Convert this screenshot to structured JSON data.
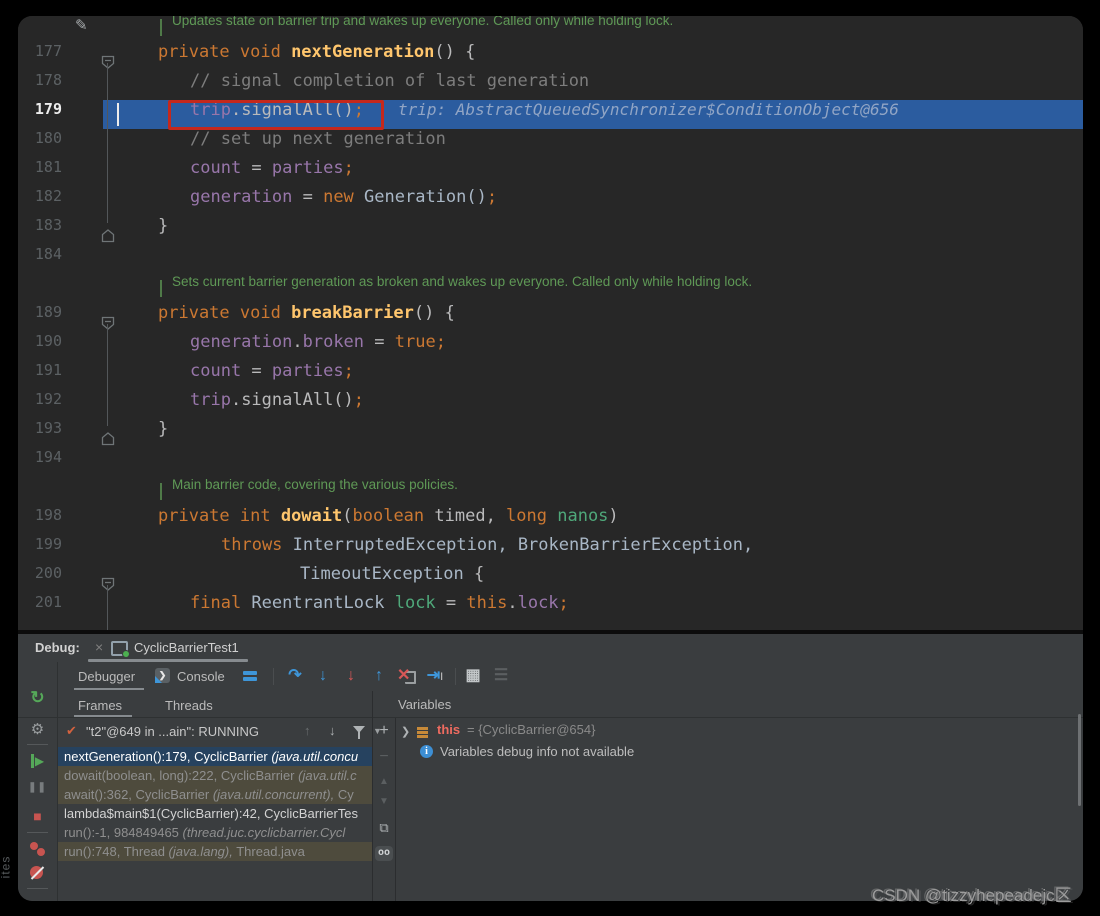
{
  "watermark": "CSDN @tizzyhepeadejc区",
  "side_label": "ites",
  "editor": {
    "lines": [
      {
        "type": "doc",
        "text": "Updates state on barrier trip and wakes up everyone. Called only while holding lock."
      },
      {
        "type": "code",
        "num": "177",
        "fold": "start",
        "indent": 0,
        "seg": [
          [
            "private void ",
            "k"
          ],
          [
            "nextGeneration",
            "m"
          ],
          [
            "() {",
            "p"
          ]
        ]
      },
      {
        "type": "code",
        "num": "178",
        "indent": 1,
        "seg": [
          [
            "// signal completion of last generation",
            "c"
          ]
        ]
      },
      {
        "type": "code",
        "num": "179",
        "exec": true,
        "box": true,
        "indent": 1,
        "seg": [
          [
            "trip",
            "f"
          ],
          [
            ".signalAll()",
            "p"
          ],
          [
            ";",
            "k"
          ]
        ],
        "hint": "trip: AbstractQueuedSynchronizer$ConditionObject@656"
      },
      {
        "type": "code",
        "num": "180",
        "indent": 1,
        "seg": [
          [
            "// set up next generation",
            "c"
          ]
        ]
      },
      {
        "type": "code",
        "num": "181",
        "indent": 1,
        "seg": [
          [
            "count",
            "f"
          ],
          [
            " = ",
            "p"
          ],
          [
            "parties",
            "f"
          ],
          [
            ";",
            "k"
          ]
        ]
      },
      {
        "type": "code",
        "num": "182",
        "indent": 1,
        "seg": [
          [
            "generation",
            "f"
          ],
          [
            " = ",
            "p"
          ],
          [
            "new ",
            "k"
          ],
          [
            "Generation()",
            "t"
          ],
          [
            ";",
            "k"
          ]
        ]
      },
      {
        "type": "code",
        "num": "183",
        "fold": "end",
        "indent": 0,
        "seg": [
          [
            "}",
            "p"
          ]
        ]
      },
      {
        "type": "code",
        "num": "184",
        "indent": 0,
        "seg": []
      },
      {
        "type": "doc",
        "text": "Sets current barrier generation as broken and wakes up everyone. Called only while holding lock."
      },
      {
        "type": "code",
        "num": "189",
        "fold": "start",
        "indent": 0,
        "seg": [
          [
            "private void ",
            "k"
          ],
          [
            "breakBarrier",
            "m"
          ],
          [
            "() {",
            "p"
          ]
        ]
      },
      {
        "type": "code",
        "num": "190",
        "indent": 1,
        "seg": [
          [
            "generation",
            "f"
          ],
          [
            ".",
            "p"
          ],
          [
            "broken",
            "f"
          ],
          [
            " = ",
            "p"
          ],
          [
            "true",
            "k"
          ],
          [
            ";",
            "k"
          ]
        ]
      },
      {
        "type": "code",
        "num": "191",
        "indent": 1,
        "seg": [
          [
            "count",
            "f"
          ],
          [
            " = ",
            "p"
          ],
          [
            "parties",
            "f"
          ],
          [
            ";",
            "k"
          ]
        ]
      },
      {
        "type": "code",
        "num": "192",
        "indent": 1,
        "seg": [
          [
            "trip",
            "f"
          ],
          [
            ".signalAll()",
            "p"
          ],
          [
            ";",
            "k"
          ]
        ]
      },
      {
        "type": "code",
        "num": "193",
        "fold": "end",
        "indent": 0,
        "seg": [
          [
            "}",
            "p"
          ]
        ]
      },
      {
        "type": "code",
        "num": "194",
        "indent": 0,
        "seg": []
      },
      {
        "type": "doc",
        "text": "Main barrier code, covering the various policies."
      },
      {
        "type": "code",
        "num": "198",
        "indent": 0,
        "seg": [
          [
            "private int ",
            "k"
          ],
          [
            "dowait",
            "m"
          ],
          [
            "(",
            "p"
          ],
          [
            "boolean",
            "k"
          ],
          [
            " timed, ",
            "p"
          ],
          [
            "long ",
            "k"
          ],
          [
            "nanos",
            "g"
          ],
          [
            ")",
            "p"
          ]
        ]
      },
      {
        "type": "code",
        "num": "199",
        "indent": 2,
        "seg": [
          [
            "throws ",
            "k"
          ],
          [
            "InterruptedException, BrokenBarrierException,",
            "t"
          ]
        ]
      },
      {
        "type": "code",
        "num": "200",
        "fold": "start",
        "indent": 3,
        "seg": [
          [
            "TimeoutException",
            "t"
          ],
          [
            " {",
            "p"
          ]
        ]
      },
      {
        "type": "code",
        "num": "201",
        "indent": 1,
        "seg": [
          [
            "final ",
            "k"
          ],
          [
            "ReentrantLock ",
            "t"
          ],
          [
            "lock",
            "g"
          ],
          [
            " = ",
            "p"
          ],
          [
            "this",
            "k"
          ],
          [
            ".",
            "p"
          ],
          [
            "lock",
            "f"
          ],
          [
            ";",
            "k"
          ]
        ]
      }
    ]
  },
  "debug": {
    "header": {
      "label": "Debug:",
      "close": "×",
      "tab": "CyclicBarrierTest1"
    },
    "tabs": {
      "debugger": "Debugger",
      "console": "Console"
    },
    "subtabs": {
      "frames": "Frames",
      "threads": "Threads"
    },
    "thread": "\"t2\"@649 in ...ain\": RUNNING",
    "frames": [
      {
        "style": "selected",
        "parts": [
          [
            "nextGeneration():179, CyclicBarrier ",
            "n"
          ],
          [
            "(java.util.concu",
            "i"
          ]
        ]
      },
      {
        "style": "lib",
        "parts": [
          [
            "dowait(boolean, long):222, CyclicBarrier ",
            "n"
          ],
          [
            "(java.util.c",
            "i"
          ]
        ]
      },
      {
        "style": "lib",
        "parts": [
          [
            "await():362, CyclicBarrier ",
            "n"
          ],
          [
            "(java.util.concurrent),",
            "i"
          ],
          [
            " Cy",
            "n"
          ]
        ]
      },
      {
        "style": "bright",
        "parts": [
          [
            "lambda$main$1(CyclicBarrier):42, CyclicBarrierTes",
            "n"
          ]
        ]
      },
      {
        "style": "dim",
        "parts": [
          [
            "run():-1, 984849465 ",
            "n"
          ],
          [
            "(thread.juc.cyclicbarrier.Cycl",
            "i"
          ]
        ]
      },
      {
        "style": "lib",
        "parts": [
          [
            "run():748, Thread ",
            "n"
          ],
          [
            "(java.lang),",
            "i"
          ],
          [
            " Thread.java",
            "n"
          ]
        ]
      }
    ],
    "variables": {
      "header": "Variables",
      "this_name": "this",
      "this_value": "= {CyclicBarrier@654}",
      "info": "Variables debug info not available"
    }
  }
}
